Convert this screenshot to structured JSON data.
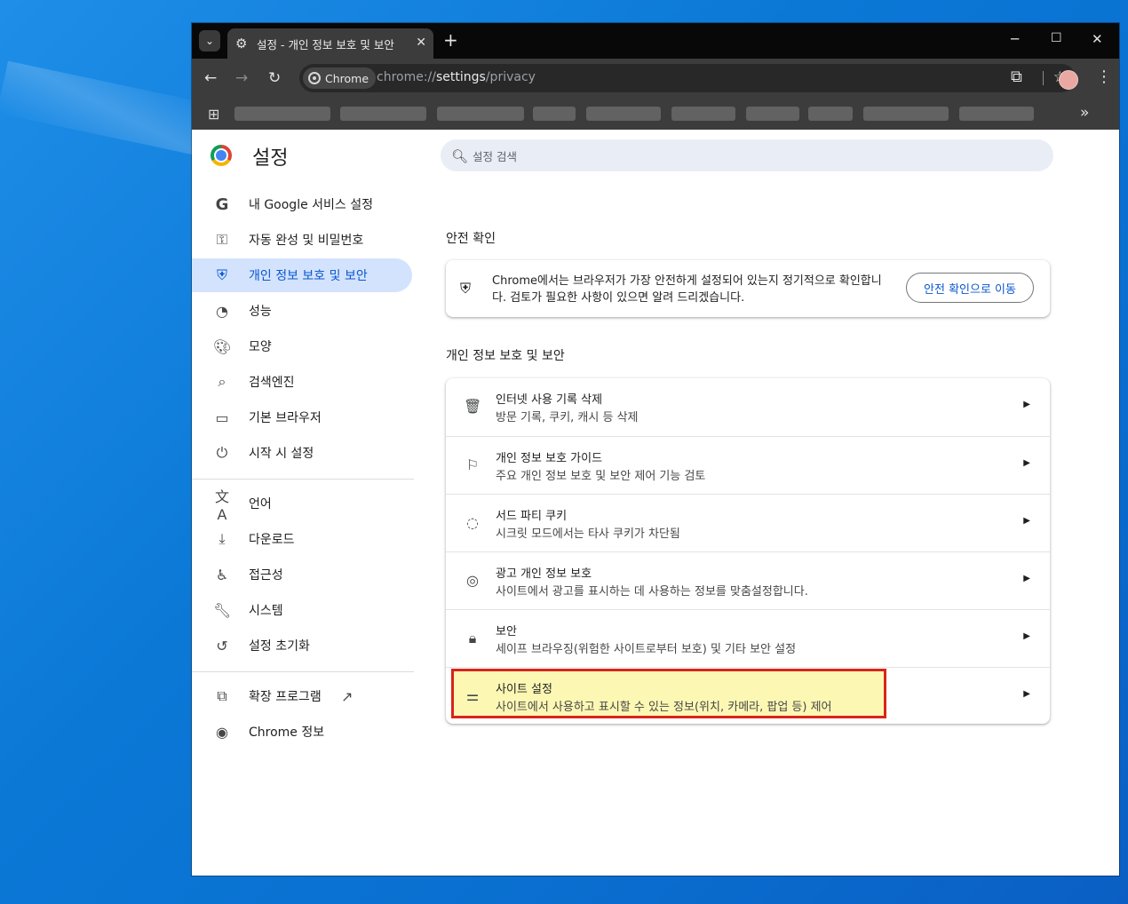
{
  "browser": {
    "tab_title": "설정 - 개인 정보 보호 및 보안",
    "chip_label": "Chrome",
    "url_prefix": "chrome://",
    "url_path_main": "settings",
    "url_path_rest": "/privacy"
  },
  "settings_title": "설정",
  "search": {
    "placeholder": "설정 검색"
  },
  "sidebar": {
    "items": [
      {
        "label": "내 Google 서비스 설정",
        "icon": "google-g-icon"
      },
      {
        "label": "자동 완성 및 비밀번호",
        "icon": "key-icon"
      },
      {
        "label": "개인 정보 보호 및 보안",
        "icon": "shield-icon",
        "active": true
      },
      {
        "label": "성능",
        "icon": "speedometer-icon"
      },
      {
        "label": "모양",
        "icon": "palette-icon"
      },
      {
        "label": "검색엔진",
        "icon": "search-icon"
      },
      {
        "label": "기본 브라우저",
        "icon": "browser-window-icon"
      },
      {
        "label": "시작 시 설정",
        "icon": "power-icon"
      },
      {
        "label": "언어",
        "icon": "translate-icon"
      },
      {
        "label": "다운로드",
        "icon": "download-icon"
      },
      {
        "label": "접근성",
        "icon": "accessibility-icon"
      },
      {
        "label": "시스템",
        "icon": "wrench-icon"
      },
      {
        "label": "설정 초기화",
        "icon": "reset-icon"
      },
      {
        "label": "확장 프로그램",
        "icon": "extension-icon"
      },
      {
        "label": "Chrome 정보",
        "icon": "chrome-icon"
      }
    ]
  },
  "safety_check": {
    "heading": "안전 확인",
    "text": "Chrome에서는 브라우저가 가장 안전하게 설정되어 있는지 정기적으로 확인합니다. 검토가 필요한 사항이 있으면 알려 드리겠습니다.",
    "button": "안전 확인으로 이동"
  },
  "privacy": {
    "heading": "개인 정보 보호 및 보안",
    "rows": [
      {
        "title": "인터넷 사용 기록 삭제",
        "subtitle": "방문 기록, 쿠키, 캐시 등 삭제",
        "icon": "trash-icon"
      },
      {
        "title": "개인 정보 보호 가이드",
        "subtitle": "주요 개인 정보 보호 및 보안 제어 기능 검토",
        "icon": "guide-icon"
      },
      {
        "title": "서드 파티 쿠키",
        "subtitle": "시크릿 모드에서는 타사 쿠키가 차단됨",
        "icon": "cookie-icon"
      },
      {
        "title": "광고 개인 정보 보호",
        "subtitle": "사이트에서 광고를 표시하는 데 사용하는 정보를 맞춤설정합니다.",
        "icon": "ad-privacy-icon"
      },
      {
        "title": "보안",
        "subtitle": "세이프 브라우징(위험한 사이트로부터 보호) 및 기타 보안 설정",
        "icon": "lock-icon"
      },
      {
        "title": "사이트 설정",
        "subtitle": "사이트에서 사용하고 표시할 수 있는 정보(위치, 카메라, 팝업 등) 제어",
        "icon": "tune-icon",
        "highlighted": true
      }
    ]
  },
  "colors": {
    "active_nav_bg": "#d3e3fd",
    "accent_blue": "#0b57d0",
    "highlight_border": "#d9241b",
    "highlight_fill": "#fcf8b4"
  }
}
